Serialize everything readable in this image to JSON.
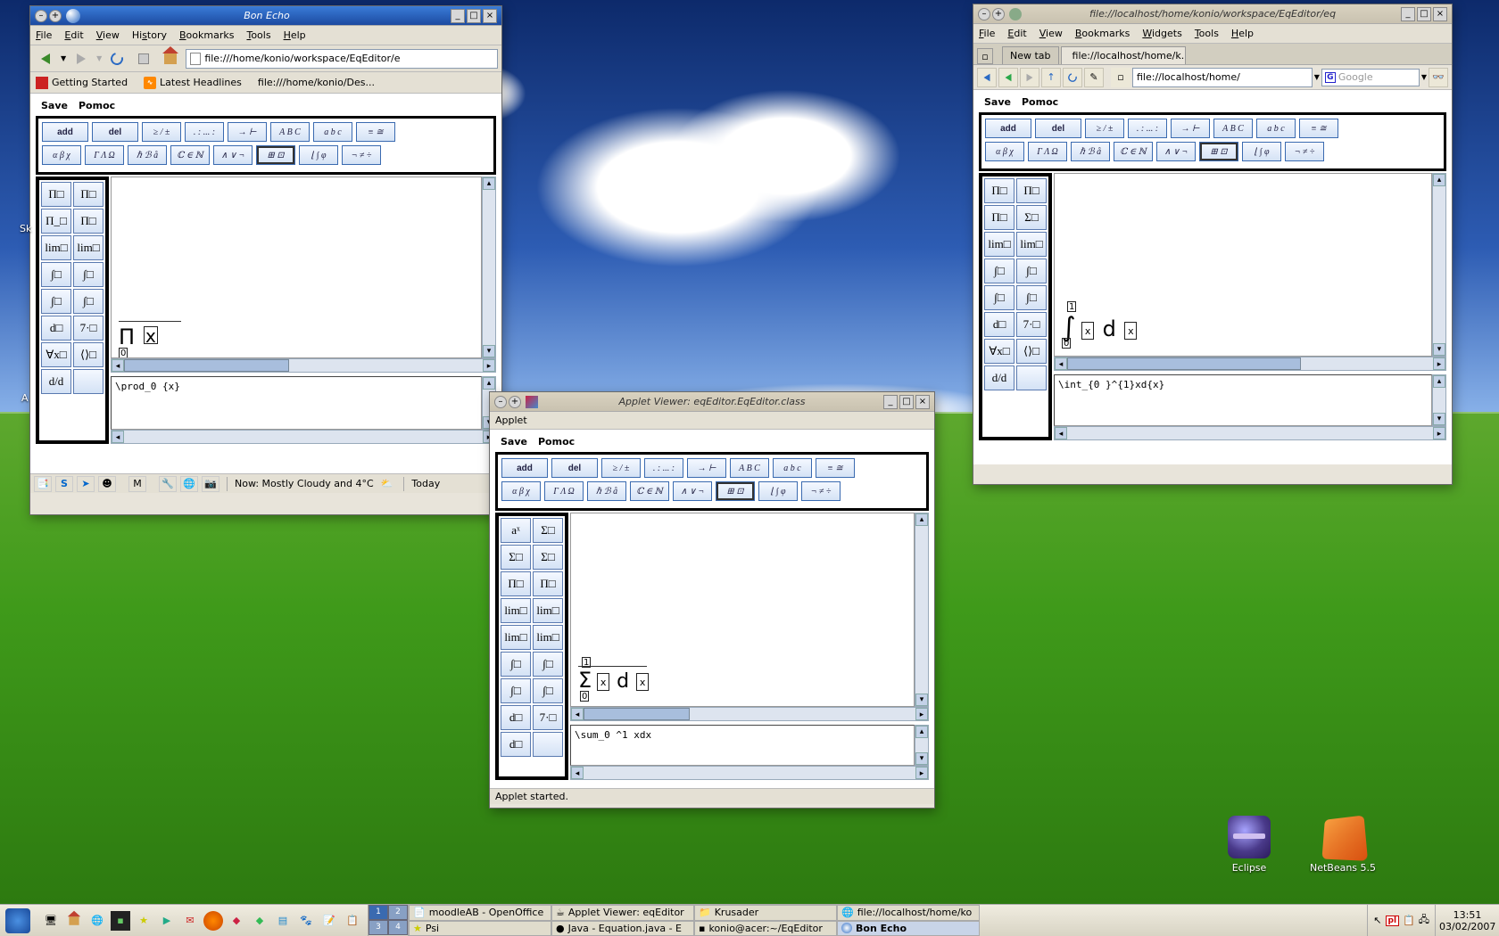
{
  "desktop": {
    "icons": [
      {
        "name": "Eclipse"
      },
      {
        "name": "NetBeans 5.5"
      }
    ]
  },
  "firefox": {
    "title": "Bon Echo",
    "menu": [
      "File",
      "Edit",
      "View",
      "History",
      "Bookmarks",
      "Tools",
      "Help"
    ],
    "url": "file:///home/konio/workspace/EqEditor/e",
    "bookmarks": {
      "getting_started": "Getting Started",
      "latest": "Latest Headlines",
      "desklink": "file:///home/konio/Des..."
    },
    "statusbar": {
      "weather": "Now: Mostly Cloudy and 4°C",
      "today": "Today"
    }
  },
  "konq": {
    "title": "file://localhost/home/konio/workspace/EqEditor/eq",
    "menu": [
      "File",
      "Edit",
      "View",
      "Bookmarks",
      "Widgets",
      "Tools",
      "Help"
    ],
    "tabs": {
      "newtab": "New tab",
      "active": "file://localhost/home/k..."
    },
    "url": "file://localhost/home/",
    "search_placeholder": "Google"
  },
  "applet": {
    "title": "Applet Viewer: eqEditor.EqEditor.class",
    "menu": "Applet",
    "status": "Applet started."
  },
  "editor": {
    "menu": [
      "Save",
      "Pomoc"
    ],
    "btns": {
      "add": "add",
      "del": "del",
      "r1": [
        "≥ / ±",
        ". : ... :",
        "→ ⊢",
        "A B C",
        "a b c",
        "≡ ≅"
      ],
      "r2": [
        "α β χ",
        "Γ Λ Ω",
        "ℏ ℬ å",
        "ℂ ∈ ℕ",
        "∧ ∨ ¬",
        "⊞ ⊡",
        "⌊ ∫ φ",
        "¬ ≠ ÷"
      ]
    },
    "palette_ff": [
      "Π□",
      "Π□",
      "Π_□",
      "Π□",
      "lim□",
      "lim□",
      "∫□",
      "∫□",
      "∫□",
      "∫□",
      "d□",
      "7·□",
      "∀x□",
      "⟨⟩□",
      "d/d",
      ""
    ],
    "palette_app": [
      "aˣ",
      "Σ□",
      "Σ□",
      "Σ□",
      "Π□",
      "Π□",
      "lim□",
      "lim□",
      "lim□",
      "lim□",
      "∫□",
      "∫□",
      "∫□",
      "∫□",
      "d□",
      "7·□",
      "d□",
      ""
    ],
    "palette_konq": [
      "Π□",
      "Π□",
      "Π□",
      "Σ□",
      "lim□",
      "lim□",
      "∫□",
      "∫□",
      "∫□",
      "∫□",
      "d□",
      "7·□",
      "∀x□",
      "⟨⟩□",
      "d/d",
      ""
    ]
  },
  "formulas": {
    "ff_display": "Π x",
    "ff_src": "\\prod_0  {x}",
    "app_display": "Σ x dx",
    "app_src": "\\sum_0 ^1  xdx",
    "konq_display": "∫ x dx",
    "konq_src": "\\int_{0 }^{1}xd{x}"
  },
  "taskbar": {
    "pager": [
      "1",
      "2",
      "3",
      "4"
    ],
    "tasks_top": [
      {
        "label": "moodleAB - OpenOffice"
      },
      {
        "label": "Applet Viewer: eqEditor"
      },
      {
        "label": "Krusader"
      },
      {
        "label": "file://localhost/home/ko"
      }
    ],
    "tasks_bot": [
      {
        "label": "Psi"
      },
      {
        "label": "Java - Equation.java - E"
      },
      {
        "label": "konio@acer:~/EqEditor"
      },
      {
        "label": "Bon Echo",
        "active": true
      }
    ],
    "tray_flag": "pl",
    "time": "13:51",
    "date": "03/02/2007"
  }
}
